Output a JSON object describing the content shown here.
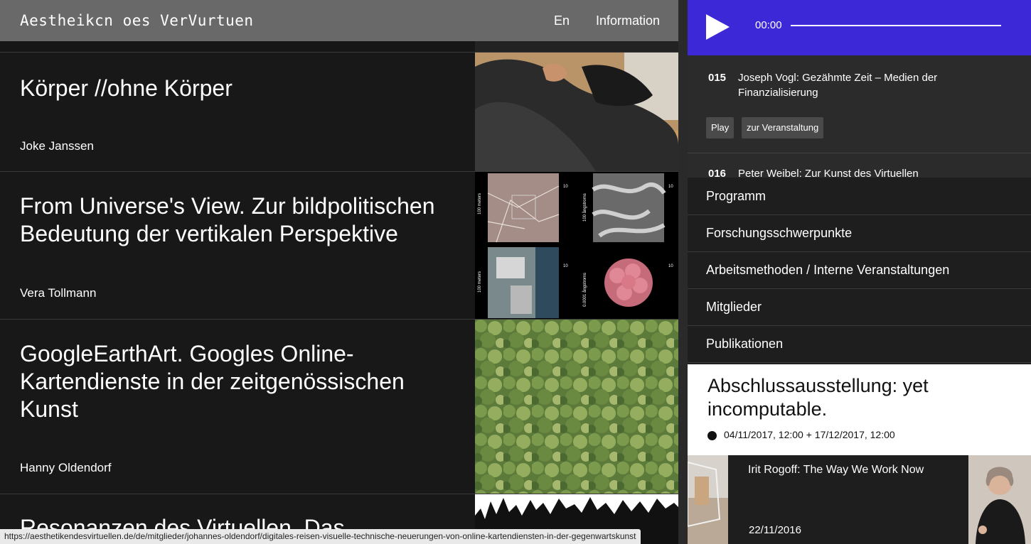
{
  "header": {
    "site_title": "Aestheikcn oes VerVurtuen",
    "lang": "En",
    "info": "Information"
  },
  "articles": [
    {
      "title": "Körper //ohne Körper",
      "author": "Joke Janssen"
    },
    {
      "title": "From Universe's View. Zur bildpolitischen Bedeutung der vertikalen Perspektive",
      "author": "Vera Tollmann"
    },
    {
      "title": "GoogleEarthArt. Googles Online-Kartendienste in der zeitgenössischen Kunst",
      "author": "Hanny Oldendorf"
    },
    {
      "title": "Resonanzen des Virtuellen. Das",
      "author": ""
    }
  ],
  "player": {
    "time": "00:00",
    "progress": 0
  },
  "playlist": [
    {
      "num": "015",
      "title": "Joseph Vogl: Gezähmte Zeit – Medien der Finanzialisierung",
      "play_label": "Play",
      "event_label": "zur Veranstaltung"
    },
    {
      "num": "016",
      "title": "Peter Weibel: Zur Kunst des Virtuellen"
    }
  ],
  "nav": {
    "items": [
      "Programm",
      "Forschungsschwerpunkte",
      "Arbeitsmethoden / Interne Veranstaltungen",
      "Mitglieder",
      "Publikationen"
    ]
  },
  "feature": {
    "title": "Abschlussausstellung: yet incomputable.",
    "dates": "04/11/2017, 12:00 + 17/12/2017, 12:00"
  },
  "event": {
    "title": "Irit Rogoff: The Way We Work Now",
    "date": "22/11/2016"
  },
  "status_bar": {
    "url": "https://aesthetikendesvirtuellen.de/de/mitglieder/johannes-oldendorf/digitales-reisen-visuelle-technische-neuerungen-von-online-kartendiensten-in-der-gegenwartskunst"
  },
  "thumb_text": {
    "t1": "100 meters",
    "t2": "10",
    "t3": "100 ångstroms",
    "t4": "10",
    "t5": "100 meters",
    "t6": "10",
    "t7": "0.0001 ångstroms",
    "t8": "10"
  },
  "colors": {
    "player_bg": "#3d28d8",
    "topbar_bg": "#696969",
    "page_bg": "#161616"
  }
}
